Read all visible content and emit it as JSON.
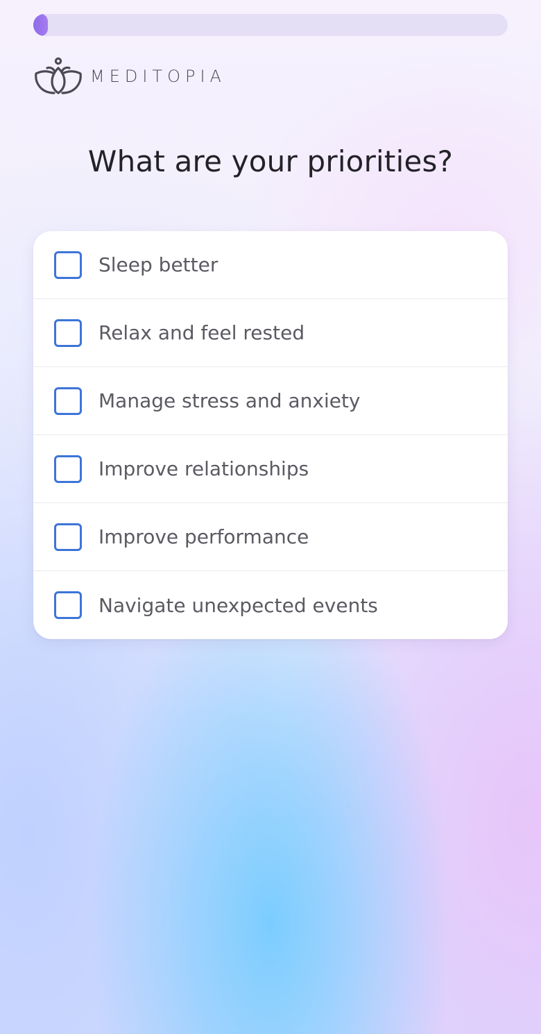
{
  "app": {
    "brand_name": "MEDITOPIA"
  },
  "progress": {
    "value_percent": 3,
    "color": "#9b74ee"
  },
  "question": {
    "title": "What are your priorities?"
  },
  "options": [
    {
      "label": "Sleep better",
      "checked": false
    },
    {
      "label": "Relax and feel rested",
      "checked": false
    },
    {
      "label": "Manage stress and anxiety",
      "checked": false
    },
    {
      "label": "Improve relationships",
      "checked": false
    },
    {
      "label": "Improve performance",
      "checked": false
    },
    {
      "label": "Navigate unexpected events",
      "checked": false
    }
  ],
  "colors": {
    "checkbox_border": "#3d74d8",
    "title_text": "#222228",
    "option_text": "#5a5a62"
  }
}
